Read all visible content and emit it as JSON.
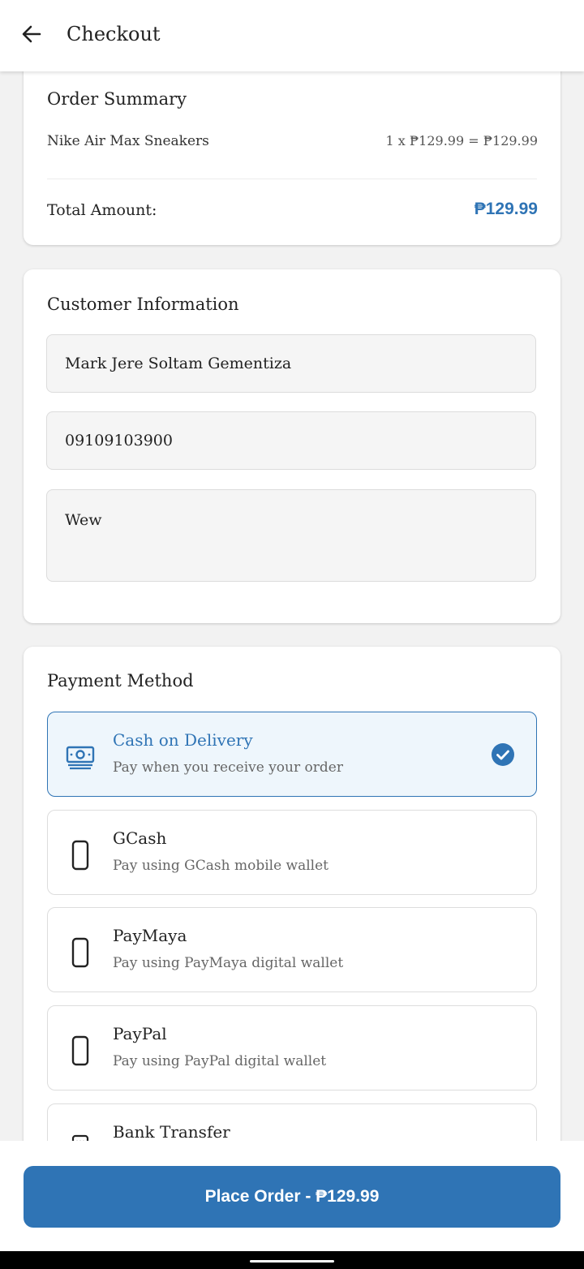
{
  "appbar": {
    "title": "Checkout",
    "back_icon": "arrow-left-icon"
  },
  "order_summary": {
    "title": "Order Summary",
    "items": [
      {
        "name": "Nike Air Max Sneakers",
        "calc": "1 x ₱129.99 = ₱129.99"
      }
    ],
    "total_label": "Total Amount:",
    "total_value": "₱129.99"
  },
  "customer": {
    "title": "Customer Information",
    "name_value": "Mark Jere Soltam Gementiza",
    "phone_value": "09109103900",
    "address_value": "Wew"
  },
  "payment": {
    "title": "Payment Method",
    "options": [
      {
        "name": "Cash on Delivery",
        "desc": "Pay when you receive your order",
        "icon": "cash-icon",
        "selected": true
      },
      {
        "name": "GCash",
        "desc": "Pay using GCash mobile wallet",
        "icon": "phone-icon",
        "selected": false
      },
      {
        "name": "PayMaya",
        "desc": "Pay using PayMaya digital wallet",
        "icon": "phone-icon",
        "selected": false
      },
      {
        "name": "PayPal",
        "desc": "Pay using PayPal digital wallet",
        "icon": "phone-icon",
        "selected": false
      },
      {
        "name": "Bank Transfer",
        "desc": "",
        "icon": "bank-icon",
        "selected": false
      }
    ]
  },
  "place_order": {
    "label": "Place Order - ₱129.99"
  },
  "colors": {
    "accent": "#2f74b5",
    "selected_bg": "#eef6fc",
    "page_bg": "#f2f2f2"
  }
}
